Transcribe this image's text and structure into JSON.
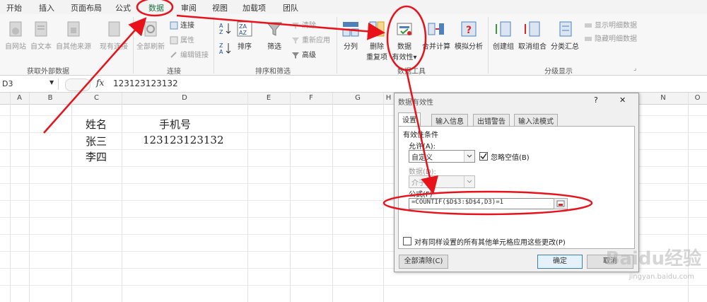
{
  "tabs": [
    "开始",
    "插入",
    "页面布局",
    "公式",
    "数据",
    "审阅",
    "视图",
    "加载项",
    "团队"
  ],
  "ribbon": {
    "get_external": {
      "label": "获取外部数据",
      "buttons": [
        "自网站",
        "自文本",
        "自其他来源",
        "现有连接"
      ]
    },
    "connections": {
      "label": "连接",
      "refresh_all": "全部刷新",
      "items": [
        "连接",
        "属性",
        "编辑链接"
      ]
    },
    "sort_filter": {
      "label": "排序和筛选",
      "sort": "排序",
      "filter": "筛选",
      "items": [
        "清除",
        "重新应用",
        "高级"
      ]
    },
    "data_tools": {
      "label": "数据工具",
      "split": "分列",
      "remove_dup": [
        "删除",
        "重复项"
      ],
      "validation": [
        "数据",
        "有效性▾"
      ],
      "consolidate": "合并计算",
      "whatif": "模拟分析"
    },
    "outline": {
      "label": "分级显示",
      "group": "创建组",
      "ungroup": "取消组合",
      "subtotal": "分类汇总",
      "items": [
        "显示明细数据",
        "隐藏明细数据"
      ]
    }
  },
  "formula_bar": {
    "name_box": "D3",
    "fx": "fx",
    "value": "123123123132"
  },
  "columns": [
    "A",
    "B",
    "C",
    "D",
    "E",
    "F",
    "G",
    "H",
    "I",
    "J",
    "K",
    "L",
    "M",
    "N",
    "O"
  ],
  "cells": {
    "c2": "姓名",
    "d2": "手机号",
    "c3": "张三",
    "d3": "123123123132",
    "c4": "李四"
  },
  "dialog": {
    "title": "数据有效性",
    "help": "?",
    "close": "✕",
    "tabs": [
      "设置",
      "输入信息",
      "出错警告",
      "输入法模式"
    ],
    "section": "有效性条件",
    "allow_label": "允许(A):",
    "allow_value": "自定义",
    "ignore_blank": "忽略空值(B)",
    "data_label": "数据(D):",
    "data_value": "介于",
    "formula_label": "公式(F)",
    "formula_value": "=COUNTIF($D$3:$D$4,D3)=1",
    "apply_all": "对有同样设置的所有其他单元格应用这些更改(P)",
    "clear_all": "全部清除(C)",
    "ok": "确定",
    "cancel": "取消"
  },
  "watermark": {
    "brand": "Baidu经验",
    "url": "jingyan.baidu.com"
  },
  "colors": {
    "annotation": "#e8131a",
    "accent": "#217346"
  }
}
